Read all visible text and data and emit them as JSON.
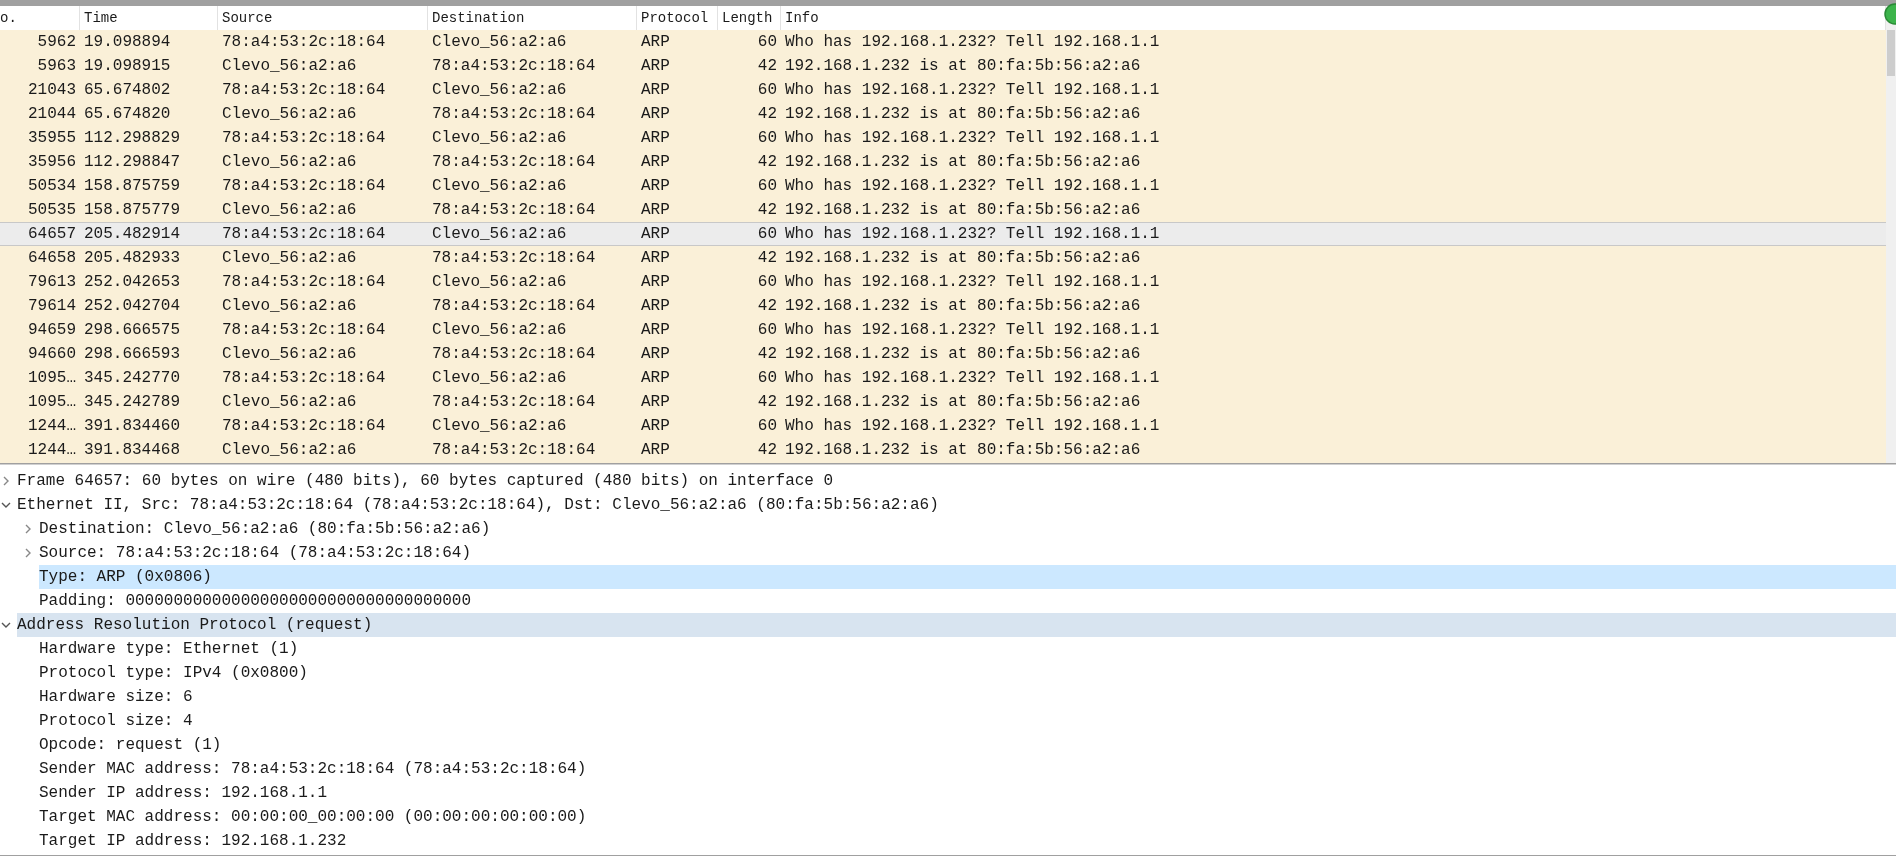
{
  "packet_list": {
    "columns": [
      "o.",
      "Time",
      "Source",
      "Destination",
      "Protocol",
      "Length",
      "Info"
    ],
    "rows": [
      {
        "no": "5962",
        "time": "19.098894",
        "source": "78:a4:53:2c:18:64",
        "destination": "Clevo_56:a2:a6",
        "protocol": "ARP",
        "length": "60",
        "info": "Who has 192.168.1.232? Tell 192.168.1.1",
        "selected": false
      },
      {
        "no": "5963",
        "time": "19.098915",
        "source": "Clevo_56:a2:a6",
        "destination": "78:a4:53:2c:18:64",
        "protocol": "ARP",
        "length": "42",
        "info": "192.168.1.232 is at 80:fa:5b:56:a2:a6",
        "selected": false
      },
      {
        "no": "21043",
        "time": "65.674802",
        "source": "78:a4:53:2c:18:64",
        "destination": "Clevo_56:a2:a6",
        "protocol": "ARP",
        "length": "60",
        "info": "Who has 192.168.1.232? Tell 192.168.1.1",
        "selected": false
      },
      {
        "no": "21044",
        "time": "65.674820",
        "source": "Clevo_56:a2:a6",
        "destination": "78:a4:53:2c:18:64",
        "protocol": "ARP",
        "length": "42",
        "info": "192.168.1.232 is at 80:fa:5b:56:a2:a6",
        "selected": false
      },
      {
        "no": "35955",
        "time": "112.298829",
        "source": "78:a4:53:2c:18:64",
        "destination": "Clevo_56:a2:a6",
        "protocol": "ARP",
        "length": "60",
        "info": "Who has 192.168.1.232? Tell 192.168.1.1",
        "selected": false
      },
      {
        "no": "35956",
        "time": "112.298847",
        "source": "Clevo_56:a2:a6",
        "destination": "78:a4:53:2c:18:64",
        "protocol": "ARP",
        "length": "42",
        "info": "192.168.1.232 is at 80:fa:5b:56:a2:a6",
        "selected": false
      },
      {
        "no": "50534",
        "time": "158.875759",
        "source": "78:a4:53:2c:18:64",
        "destination": "Clevo_56:a2:a6",
        "protocol": "ARP",
        "length": "60",
        "info": "Who has 192.168.1.232? Tell 192.168.1.1",
        "selected": false
      },
      {
        "no": "50535",
        "time": "158.875779",
        "source": "Clevo_56:a2:a6",
        "destination": "78:a4:53:2c:18:64",
        "protocol": "ARP",
        "length": "42",
        "info": "192.168.1.232 is at 80:fa:5b:56:a2:a6",
        "selected": false
      },
      {
        "no": "64657",
        "time": "205.482914",
        "source": "78:a4:53:2c:18:64",
        "destination": "Clevo_56:a2:a6",
        "protocol": "ARP",
        "length": "60",
        "info": "Who has 192.168.1.232? Tell 192.168.1.1",
        "selected": true
      },
      {
        "no": "64658",
        "time": "205.482933",
        "source": "Clevo_56:a2:a6",
        "destination": "78:a4:53:2c:18:64",
        "protocol": "ARP",
        "length": "42",
        "info": "192.168.1.232 is at 80:fa:5b:56:a2:a6",
        "selected": false
      },
      {
        "no": "79613",
        "time": "252.042653",
        "source": "78:a4:53:2c:18:64",
        "destination": "Clevo_56:a2:a6",
        "protocol": "ARP",
        "length": "60",
        "info": "Who has 192.168.1.232? Tell 192.168.1.1",
        "selected": false
      },
      {
        "no": "79614",
        "time": "252.042704",
        "source": "Clevo_56:a2:a6",
        "destination": "78:a4:53:2c:18:64",
        "protocol": "ARP",
        "length": "42",
        "info": "192.168.1.232 is at 80:fa:5b:56:a2:a6",
        "selected": false
      },
      {
        "no": "94659",
        "time": "298.666575",
        "source": "78:a4:53:2c:18:64",
        "destination": "Clevo_56:a2:a6",
        "protocol": "ARP",
        "length": "60",
        "info": "Who has 192.168.1.232? Tell 192.168.1.1",
        "selected": false
      },
      {
        "no": "94660",
        "time": "298.666593",
        "source": "Clevo_56:a2:a6",
        "destination": "78:a4:53:2c:18:64",
        "protocol": "ARP",
        "length": "42",
        "info": "192.168.1.232 is at 80:fa:5b:56:a2:a6",
        "selected": false
      },
      {
        "no": "1095…",
        "time": "345.242770",
        "source": "78:a4:53:2c:18:64",
        "destination": "Clevo_56:a2:a6",
        "protocol": "ARP",
        "length": "60",
        "info": "Who has 192.168.1.232? Tell 192.168.1.1",
        "selected": false
      },
      {
        "no": "1095…",
        "time": "345.242789",
        "source": "Clevo_56:a2:a6",
        "destination": "78:a4:53:2c:18:64",
        "protocol": "ARP",
        "length": "42",
        "info": "192.168.1.232 is at 80:fa:5b:56:a2:a6",
        "selected": false
      },
      {
        "no": "1244…",
        "time": "391.834460",
        "source": "78:a4:53:2c:18:64",
        "destination": "Clevo_56:a2:a6",
        "protocol": "ARP",
        "length": "60",
        "info": "Who has 192.168.1.232? Tell 192.168.1.1",
        "selected": false
      },
      {
        "no": "1244…",
        "time": "391.834468",
        "source": "Clevo_56:a2:a6",
        "destination": "78:a4:53:2c:18:64",
        "protocol": "ARP",
        "length": "42",
        "info": "192.168.1.232 is at 80:fa:5b:56:a2:a6",
        "selected": false
      }
    ]
  },
  "packet_details": [
    {
      "text": "Frame 64657: 60 bytes on wire (480 bits), 60 bytes captured (480 bits) on interface 0",
      "expanded": false,
      "selected": false,
      "hovered": false
    },
    {
      "text": "Ethernet II, Src: 78:a4:53:2c:18:64 (78:a4:53:2c:18:64), Dst: Clevo_56:a2:a6 (80:fa:5b:56:a2:a6)",
      "expanded": true,
      "selected": false,
      "hovered": false,
      "children": [
        {
          "text": "Destination: Clevo_56:a2:a6 (80:fa:5b:56:a2:a6)",
          "expanded": false,
          "selected": false,
          "hovered": false
        },
        {
          "text": "Source: 78:a4:53:2c:18:64 (78:a4:53:2c:18:64)",
          "expanded": false,
          "selected": false,
          "hovered": false
        },
        {
          "text": "Type: ARP (0x0806)",
          "selected": true,
          "hovered": false
        },
        {
          "text": "Padding: 000000000000000000000000000000000000",
          "selected": false,
          "hovered": false
        }
      ]
    },
    {
      "text": "Address Resolution Protocol (request)",
      "expanded": true,
      "selected": false,
      "hovered": true,
      "children": [
        {
          "text": "Hardware type: Ethernet (1)",
          "selected": false,
          "hovered": false
        },
        {
          "text": "Protocol type: IPv4 (0x0800)",
          "selected": false,
          "hovered": false
        },
        {
          "text": "Hardware size: 6",
          "selected": false,
          "hovered": false
        },
        {
          "text": "Protocol size: 4",
          "selected": false,
          "hovered": false
        },
        {
          "text": "Opcode: request (1)",
          "selected": false,
          "hovered": false
        },
        {
          "text": "Sender MAC address: 78:a4:53:2c:18:64 (78:a4:53:2c:18:64)",
          "selected": false,
          "hovered": false
        },
        {
          "text": "Sender IP address: 192.168.1.1",
          "selected": false,
          "hovered": false
        },
        {
          "text": "Target MAC address: 00:00:00_00:00:00 (00:00:00:00:00:00)",
          "selected": false,
          "hovered": false
        },
        {
          "text": "Target IP address: 192.168.1.232",
          "selected": false,
          "hovered": false
        }
      ]
    }
  ]
}
